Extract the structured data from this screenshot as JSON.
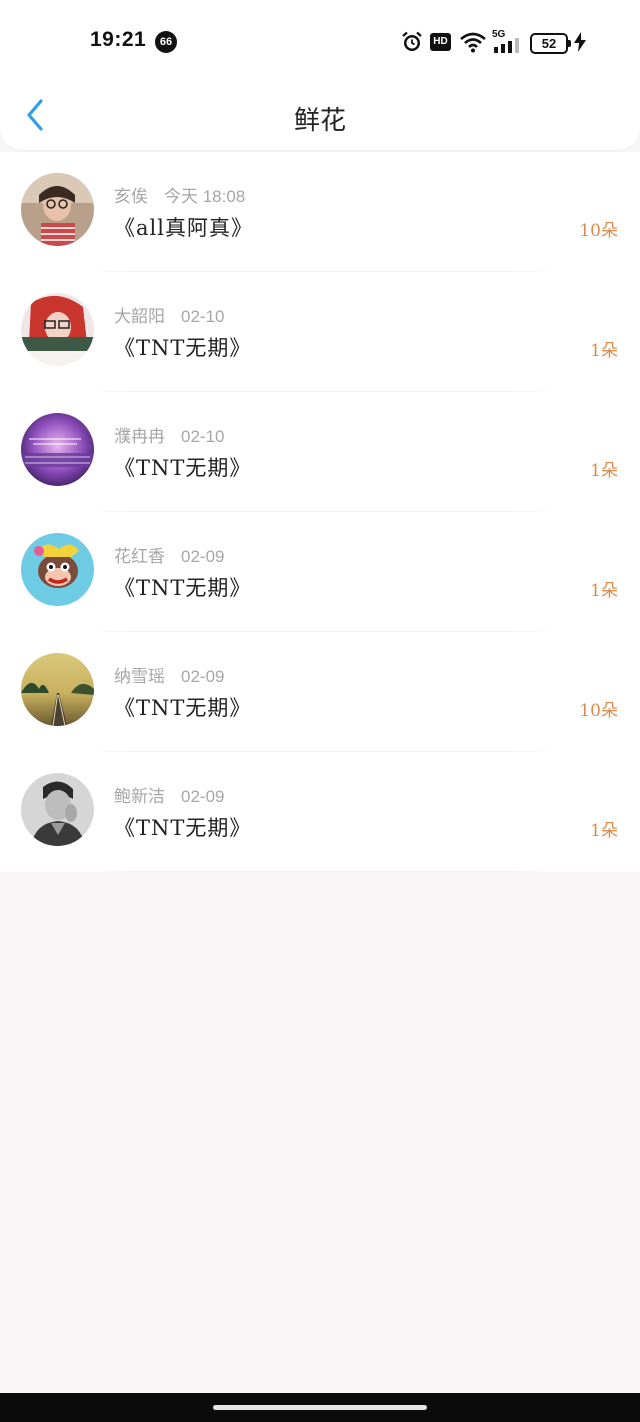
{
  "status_bar": {
    "time": "19:21",
    "notification_count": "66",
    "battery": "52",
    "hd_label": "HD",
    "network_label": "5G"
  },
  "header": {
    "title": "鲜花"
  },
  "list": [
    {
      "name": "亥俟",
      "time": "今天 18:08",
      "book": "《all真阿真》",
      "count": "10朵"
    },
    {
      "name": "大韶阳",
      "time": "02-10",
      "book": "《TNT无期》",
      "count": "1朵"
    },
    {
      "name": "濮冉冉",
      "time": "02-10",
      "book": "《TNT无期》",
      "count": "1朵"
    },
    {
      "name": "花红香",
      "time": "02-09",
      "book": "《TNT无期》",
      "count": "1朵"
    },
    {
      "name": "纳雪瑶",
      "time": "02-09",
      "book": "《TNT无期》",
      "count": "10朵"
    },
    {
      "name": "鲍新洁",
      "time": "02-09",
      "book": "《TNT无期》",
      "count": "1朵"
    }
  ],
  "colors": {
    "accent": "#2f9fe6",
    "count": "#e08a4a",
    "meta": "#a6a6a6"
  }
}
